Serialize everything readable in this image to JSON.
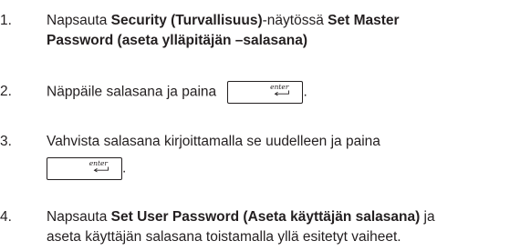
{
  "steps": [
    {
      "number": "1.",
      "line1_pre": "Napsauta ",
      "line1_bold1": "Security (Turvallisuus)",
      "line1_mid": "-näytössä ",
      "line1_bold2": "Set Master",
      "line2_bold": "Password (aseta ylläpitäjän –salasana)"
    },
    {
      "number": "2.",
      "text_pre": "Näppäile salasana ja paina",
      "text_post": "."
    },
    {
      "number": "3.",
      "line1": "Vahvista salasana kirjoittamalla se uudelleen ja paina",
      "line2_post": "."
    },
    {
      "number": "4.",
      "line1_pre": "Napsauta ",
      "line1_bold": "Set User Password (Aseta käyttäjän salasana)",
      "line1_post": " ja",
      "line2": "aseta käyttäjän salasana toistamalla yllä esitetyt vaiheet."
    }
  ],
  "enter_key": {
    "label": "enter",
    "icon": "enter-arrow-icon"
  }
}
